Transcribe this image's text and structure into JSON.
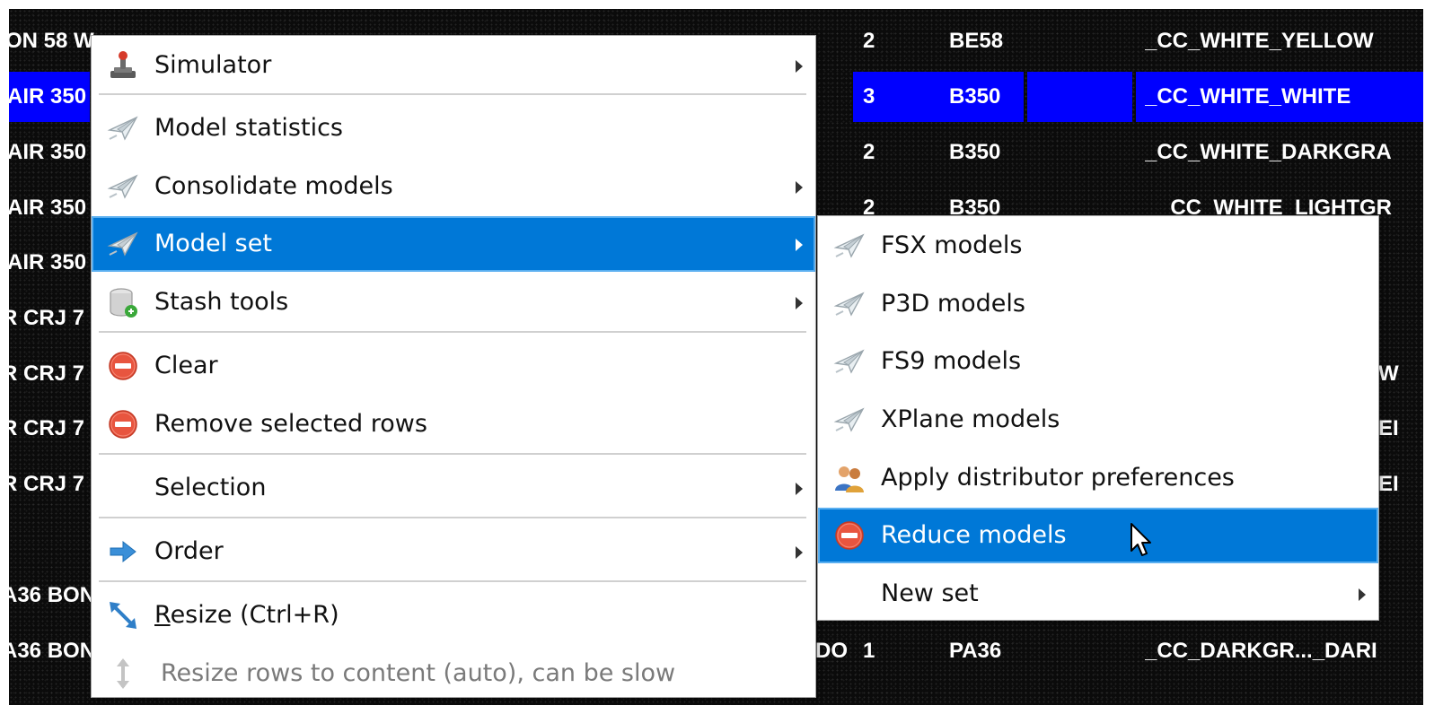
{
  "table": {
    "rows": [
      {
        "model": "ON 58 W",
        "sim": "",
        "cnt": "2",
        "icao": "BE58",
        "livery": "_CC_WHITE_YELLOW",
        "selected": false
      },
      {
        "model": "AIR 350",
        "sim": "",
        "cnt": "3",
        "icao": "B350",
        "livery": "_CC_WHITE_WHITE",
        "selected": true
      },
      {
        "model": "AIR 350",
        "sim": "",
        "cnt": "2",
        "icao": "B350",
        "livery": "_CC_WHITE_DARKGRA",
        "selected": false
      },
      {
        "model": "AIR 350",
        "sim": "",
        "cnt": "2",
        "icao": "B350",
        "livery": "_CC_WHITE_LIGHTGR",
        "selected": false
      },
      {
        "model": "AIR 350",
        "sim": "",
        "cnt": "",
        "icao": "",
        "livery": "",
        "selected": false
      },
      {
        "model": "R CRJ 7",
        "sim": "",
        "cnt": "",
        "icao": "",
        "livery": "",
        "selected": false
      },
      {
        "model": "R CRJ 7",
        "sim": "",
        "cnt": "",
        "icao": "",
        "livery": "W",
        "selected": false
      },
      {
        "model": "R CRJ 7",
        "sim": "",
        "cnt": "",
        "icao": "",
        "livery": "EI",
        "selected": false
      },
      {
        "model": "R CRJ 7",
        "sim": "",
        "cnt": "",
        "icao": "",
        "livery": "EI",
        "selected": false
      },
      {
        "model": "",
        "sim": "",
        "cnt": "",
        "icao": "",
        "livery": "",
        "selected": false
      },
      {
        "model": "A36 BON",
        "sim": "",
        "cnt": "",
        "icao": "",
        "livery": "",
        "selected": false
      },
      {
        "model": "A36 BON",
        "sim": "DO",
        "cnt": "1",
        "icao": "PA36",
        "livery": "_CC_DARKGR..._DARI",
        "selected": false
      }
    ]
  },
  "context_menu": {
    "items": [
      {
        "label": "Simulator",
        "icon": "simulator-icon",
        "submenu": true
      },
      {
        "label": "Model statistics",
        "icon": "plane-icon",
        "submenu": false
      },
      {
        "label": "Consolidate models",
        "icon": "plane-icon",
        "submenu": true
      },
      {
        "label": "Model set",
        "icon": "plane-icon",
        "submenu": true,
        "highlighted": true
      },
      {
        "label": "Stash tools",
        "icon": "database-icon",
        "submenu": true
      },
      {
        "label": "Clear",
        "icon": "remove-icon",
        "submenu": false
      },
      {
        "label": "Remove selected rows",
        "icon": "remove-icon",
        "submenu": false
      },
      {
        "label": "Selection",
        "icon": "",
        "submenu": true
      },
      {
        "label": "Order",
        "icon": "arrow-right-icon",
        "submenu": true
      },
      {
        "label": "Resize (Ctrl+R)",
        "icon": "resize-icon",
        "submenu": false
      },
      {
        "label": "Resize rows to content (auto), can be slow",
        "icon": "resize-vertical-icon",
        "submenu": false,
        "disabled": true
      }
    ]
  },
  "submenu": {
    "items": [
      {
        "label": "FSX models",
        "icon": "plane-icon"
      },
      {
        "label": "P3D models",
        "icon": "plane-icon"
      },
      {
        "label": "FS9 models",
        "icon": "plane-icon"
      },
      {
        "label": "XPlane models",
        "icon": "plane-icon"
      },
      {
        "label": "Apply distributor preferences",
        "icon": "distributor-icon"
      },
      {
        "label": "Reduce models",
        "icon": "remove-icon",
        "highlighted": true
      },
      {
        "label": "New set",
        "icon": "",
        "submenu": true
      }
    ]
  },
  "colors": {
    "menu_highlight": "#0078d7",
    "row_selected": "#0000ff",
    "table_bg": "#0b0b0b"
  }
}
